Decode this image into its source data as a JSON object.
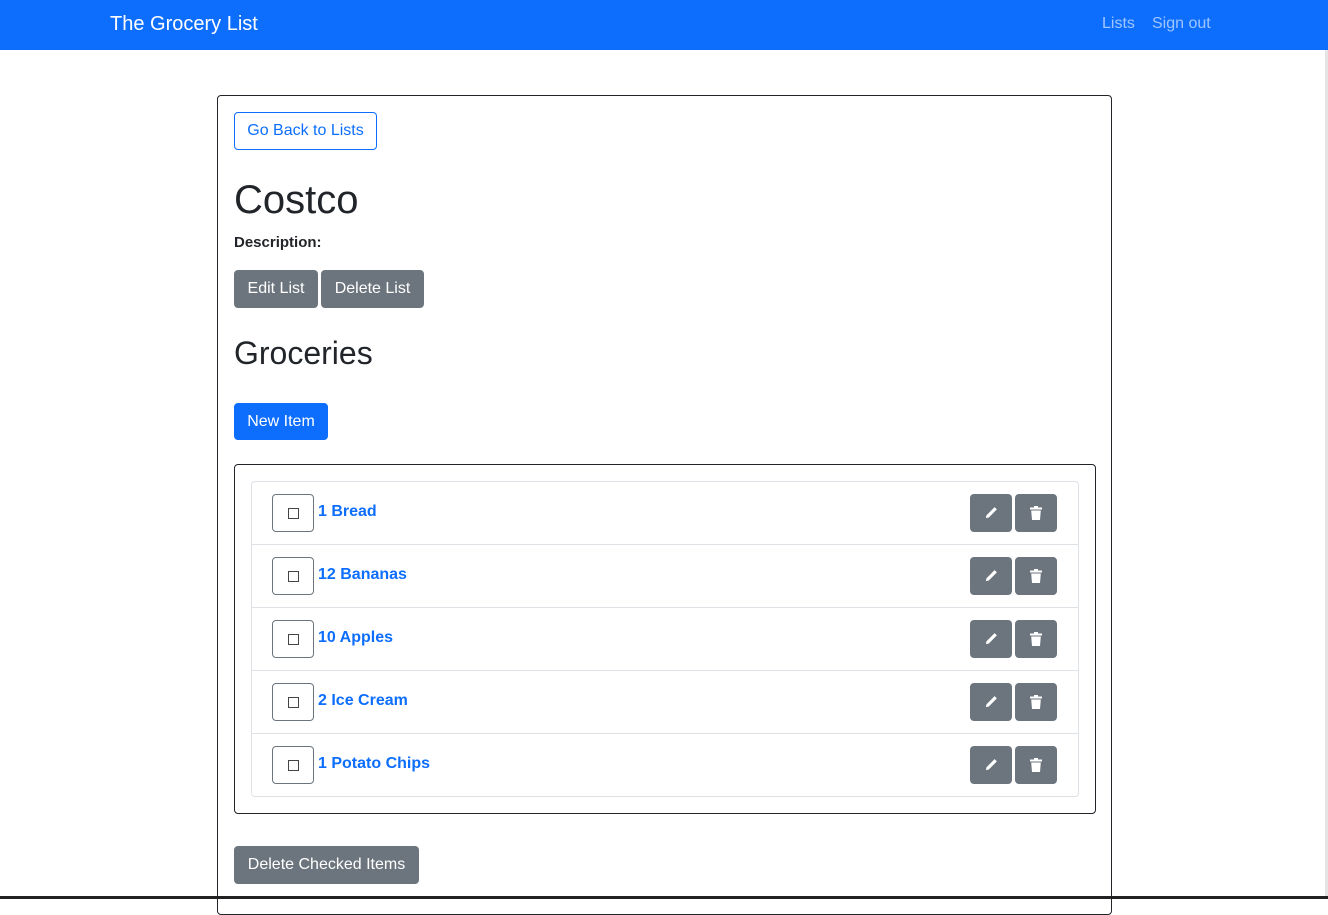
{
  "navbar": {
    "brand": "The Grocery List",
    "links": [
      "Lists",
      "Sign out"
    ],
    "color": "#0d6efd"
  },
  "list": {
    "back_label": "Go Back to Lists",
    "title": "Costco",
    "description_label": "Description:",
    "edit_label": "Edit List",
    "delete_label": "Delete List"
  },
  "groceries": {
    "heading": "Groceries",
    "new_item_label": "New Item",
    "items": [
      {
        "label": "1 Bread",
        "checked": false
      },
      {
        "label": "12 Bananas",
        "checked": false
      },
      {
        "label": "10 Apples",
        "checked": false
      },
      {
        "label": "2 Ice Cream",
        "checked": false
      },
      {
        "label": "1 Potato Chips",
        "checked": false
      }
    ],
    "row_icons": [
      "pencil-icon",
      "trash-icon"
    ],
    "delete_checked_label": "Delete Checked Items"
  }
}
